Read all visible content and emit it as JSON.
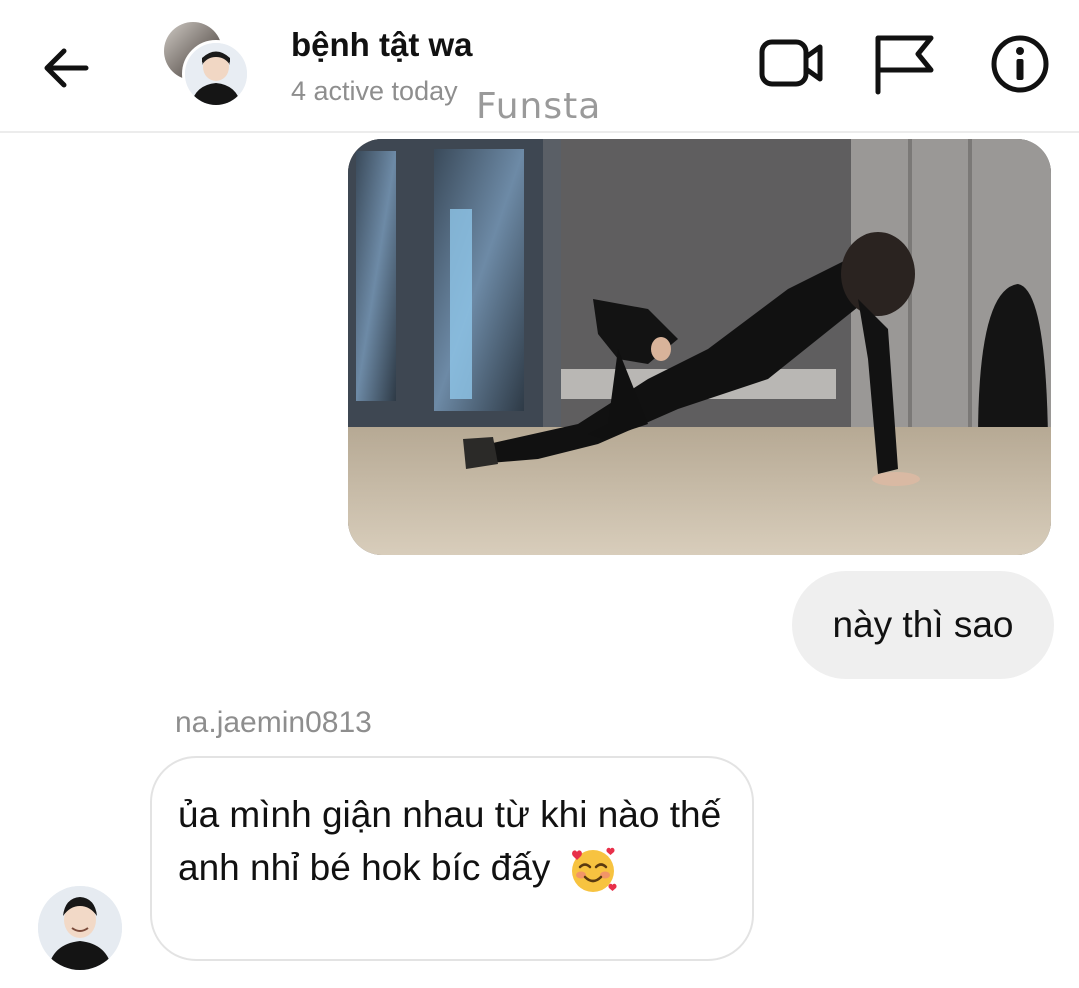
{
  "header": {
    "title": "bệnh tật wa",
    "status": "4 active today"
  },
  "watermark": "Funsta",
  "icons": {
    "back": "arrow-left-icon",
    "video": "video-camera-icon",
    "flag": "flag-icon",
    "info": "info-icon"
  },
  "messages": {
    "outgoing_photo": "dance-photo",
    "outgoing_text": "này thì sao",
    "incoming_sender": "na.jaemin0813",
    "incoming_text": "ủa mình giận nhau từ khi nào thế anh nhỉ bé hok bíc đấy",
    "incoming_emoji": "smiling-face-with-hearts-emoji"
  },
  "colors": {
    "bubble_outgoing": "#efefef",
    "bubble_incoming_border": "#e3e3e3",
    "secondary_text": "#8e8e8e"
  }
}
